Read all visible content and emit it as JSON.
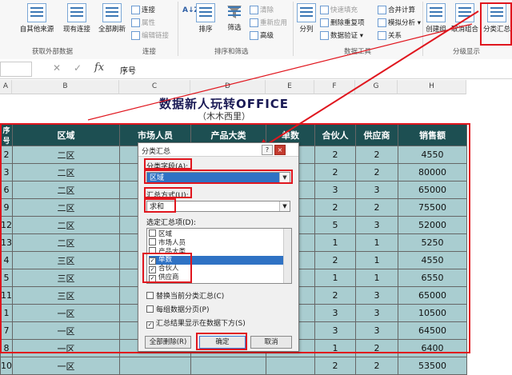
{
  "ribbon": {
    "from_other_sources": "自其他来源",
    "existing_connections": "现有连接",
    "refresh_all": "全部刷新",
    "connections": "连接",
    "properties": "属性",
    "edit_links": "编辑链接",
    "sort_az": "A↓Z",
    "sort": "排序",
    "filter": "筛选",
    "clear": "清除",
    "reapply": "重新应用",
    "advanced": "高级",
    "text_to_columns": "分列",
    "flash_fill": "快速填充",
    "remove_duplicates": "删除重复项",
    "data_validation": "数据验证 ▾",
    "consolidate": "合并计算",
    "what_if": "模拟分析 ▾",
    "relationships": "关系",
    "group": "创建组",
    "ungroup": "取消组合",
    "subtotal": "分类汇总",
    "group_external": "获取外部数据",
    "group_connections": "连接",
    "group_sortfilter": "排序和筛选",
    "group_datatools": "数据工具",
    "group_outline": "分级显示"
  },
  "formula_bar": {
    "fx": "fx",
    "content": "序号"
  },
  "columns": [
    "A",
    "B",
    "C",
    "D",
    "E",
    "F",
    "G",
    "H"
  ],
  "sheet": {
    "title": "数据新人玩转OFFICE",
    "subtitle": "（木木西里）",
    "headers": [
      "序号",
      "区域",
      "市场人员",
      "产品大类",
      "单数",
      "合伙人",
      "供应商",
      "销售额"
    ],
    "rows": [
      [
        "2",
        "二区",
        "",
        "",
        "",
        "2",
        "2",
        "4550"
      ],
      [
        "3",
        "二区",
        "",
        "",
        "",
        "2",
        "2",
        "80000"
      ],
      [
        "6",
        "二区",
        "",
        "",
        "",
        "3",
        "3",
        "65000"
      ],
      [
        "9",
        "二区",
        "",
        "",
        "",
        "2",
        "2",
        "75500"
      ],
      [
        "12",
        "二区",
        "",
        "",
        "",
        "5",
        "3",
        "52000"
      ],
      [
        "13",
        "二区",
        "",
        "",
        "",
        "1",
        "1",
        "5250"
      ],
      [
        "4",
        "三区",
        "",
        "",
        "",
        "2",
        "1",
        "4550"
      ],
      [
        "5",
        "三区",
        "",
        "",
        "",
        "1",
        "1",
        "6550"
      ],
      [
        "11",
        "三区",
        "",
        "",
        "",
        "2",
        "3",
        "65000"
      ],
      [
        "1",
        "一区",
        "",
        "",
        "",
        "3",
        "3",
        "10500"
      ],
      [
        "7",
        "一区",
        "",
        "",
        "",
        "3",
        "3",
        "64500"
      ],
      [
        "8",
        "一区",
        "",
        "",
        "",
        "1",
        "2",
        "6400"
      ],
      [
        "10",
        "一区",
        "",
        "",
        "",
        "2",
        "2",
        "53500"
      ]
    ]
  },
  "dialog": {
    "title": "分类汇总",
    "help": "?",
    "close": "×",
    "field_label": "分类字段(A):",
    "field_value": "区域",
    "func_label": "汇总方式(U):",
    "func_value": "求和",
    "items_label": "选定汇总项(D):",
    "items": [
      {
        "label": "区域",
        "checked": false
      },
      {
        "label": "市场人员",
        "checked": false
      },
      {
        "label": "产品大类",
        "checked": false
      },
      {
        "label": "单数",
        "checked": true
      },
      {
        "label": "合伙人",
        "checked": true
      },
      {
        "label": "供应商",
        "checked": true
      }
    ],
    "opt_replace": "替换当前分类汇总(C)",
    "opt_pagebreak": "每组数据分页(P)",
    "opt_below": "汇总结果显示在数据下方(S)",
    "btn_remove_all": "全部删除(R)",
    "btn_ok": "确定",
    "btn_cancel": "取消"
  }
}
